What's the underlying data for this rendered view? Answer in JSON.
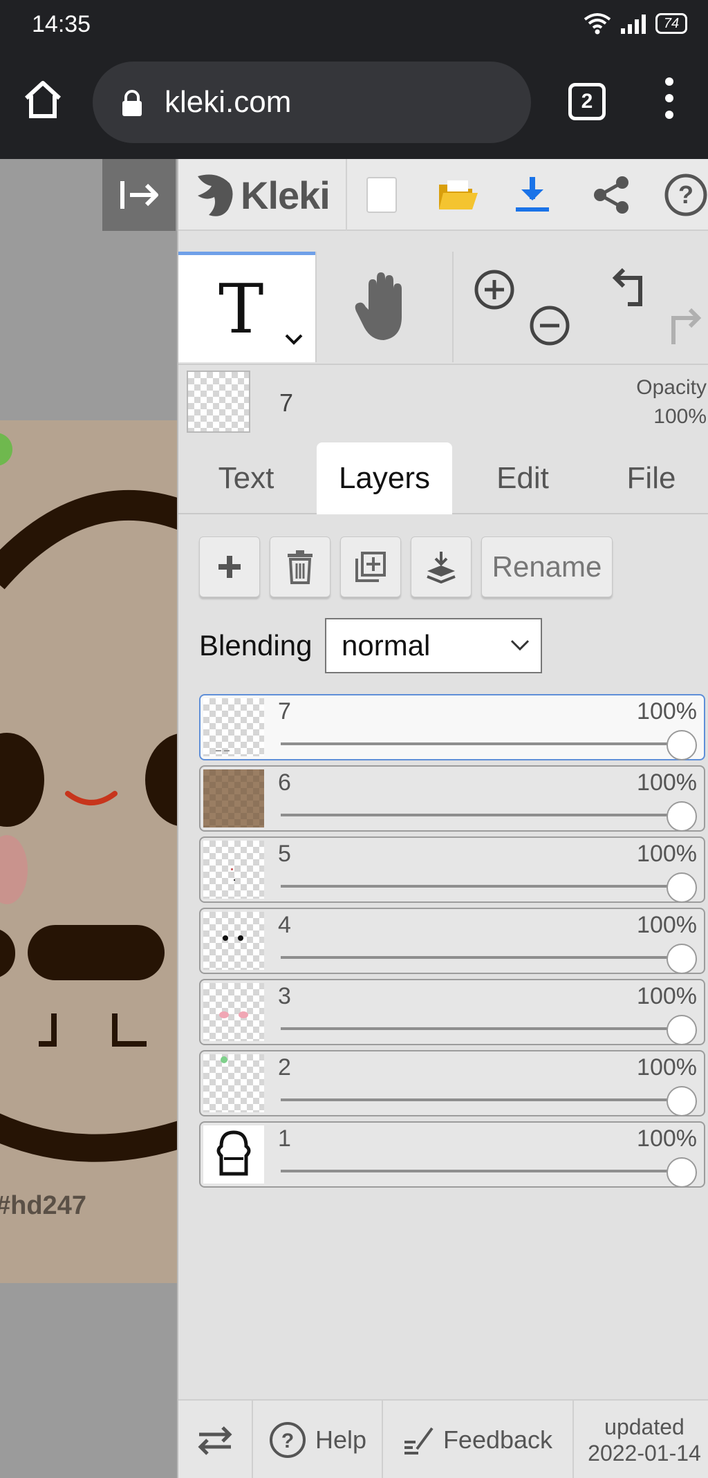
{
  "status_bar": {
    "time": "14:35",
    "battery": "74",
    "icons": [
      "wifi-icon",
      "signal-icon",
      "battery-icon"
    ]
  },
  "browser": {
    "url": "kleki.com",
    "tab_count": "2",
    "icons": [
      "home-icon",
      "lock-icon",
      "tabs-icon",
      "menu-icon"
    ]
  },
  "canvas": {
    "watermark": "#hd247"
  },
  "app": {
    "logo_text": "Kleki",
    "topbar_icons": [
      "new-image-icon",
      "open-folder-icon",
      "download-icon",
      "share-icon",
      "help-icon"
    ],
    "accent_color": "#1a73e8"
  },
  "tools": {
    "text_tool_glyph": "T",
    "icons": [
      "hand-icon",
      "zoom-in-icon",
      "zoom-out-icon",
      "undo-icon",
      "redo-icon"
    ]
  },
  "current_layer": {
    "name": "7",
    "opacity_label": "Opacity",
    "opacity_value": "100%"
  },
  "tabs": [
    {
      "label": "Text"
    },
    {
      "label": "Layers"
    },
    {
      "label": "Edit"
    },
    {
      "label": "File"
    }
  ],
  "active_tab": "Layers",
  "layer_actions": {
    "rename_label": "Rename",
    "icons": [
      "add-layer-icon",
      "delete-layer-icon",
      "duplicate-layer-icon",
      "merge-down-icon"
    ]
  },
  "blending": {
    "label": "Blending",
    "value": "normal"
  },
  "layers": [
    {
      "name": "7",
      "opacity": "100%",
      "selected": true
    },
    {
      "name": "6",
      "opacity": "100%",
      "selected": false
    },
    {
      "name": "5",
      "opacity": "100%",
      "selected": false
    },
    {
      "name": "4",
      "opacity": "100%",
      "selected": false
    },
    {
      "name": "3",
      "opacity": "100%",
      "selected": false
    },
    {
      "name": "2",
      "opacity": "100%",
      "selected": false
    },
    {
      "name": "1",
      "opacity": "100%",
      "selected": false
    }
  ],
  "footer": {
    "help_label": "Help",
    "feedback_label": "Feedback",
    "updated_label": "updated",
    "updated_date": "2022-01-14"
  }
}
